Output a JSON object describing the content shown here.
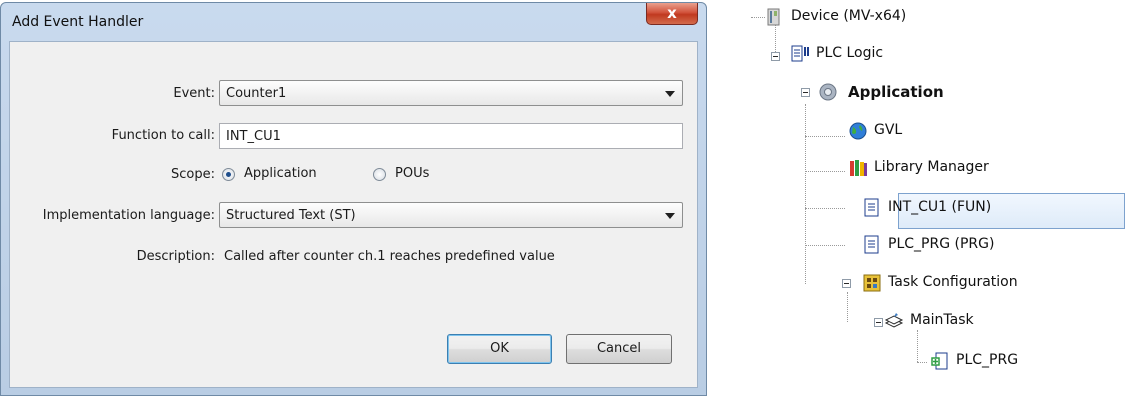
{
  "dialog": {
    "title": "Add Event Handler",
    "close_glyph": "x",
    "event": {
      "label": "Event:",
      "value": "Counter1"
    },
    "function": {
      "label": "Function to call:",
      "value": "INT_CU1"
    },
    "scope": {
      "label": "Scope:",
      "options": [
        {
          "label": "Application",
          "selected": true
        },
        {
          "label": "POUs",
          "selected": false
        }
      ]
    },
    "language": {
      "label": "Implementation language:",
      "value": "Structured Text (ST)"
    },
    "description": {
      "label": "Description:",
      "value": "Called after counter ch.1 reaches predefined value"
    },
    "ok_label": "OK",
    "cancel_label": "Cancel"
  },
  "tree": {
    "device": {
      "label": "Device (MV-x64)",
      "icon": "device-icon"
    },
    "plc_logic": {
      "label": "PLC Logic",
      "icon": "plc-logic-icon"
    },
    "application": {
      "label": "Application",
      "icon": "gear-icon"
    },
    "gvl": {
      "label": "GVL",
      "icon": "globe-icon"
    },
    "library_manager": {
      "label": "Library Manager",
      "icon": "books-icon"
    },
    "int_cu1": {
      "label": "INT_CU1 (FUN)",
      "icon": "document-icon",
      "selected": true
    },
    "plc_prg": {
      "label": "PLC_PRG (PRG)",
      "icon": "document-icon"
    },
    "task_config": {
      "label": "Task Configuration",
      "icon": "task-config-icon"
    },
    "main_task": {
      "label": "MainTask",
      "icon": "task-icon"
    },
    "task_plc_prg": {
      "label": "PLC_PRG",
      "icon": "program-call-icon"
    }
  },
  "colors": {
    "selection_border": "#7da2ce",
    "titlebar": "#c9daee",
    "close_button": "#c0391f"
  }
}
